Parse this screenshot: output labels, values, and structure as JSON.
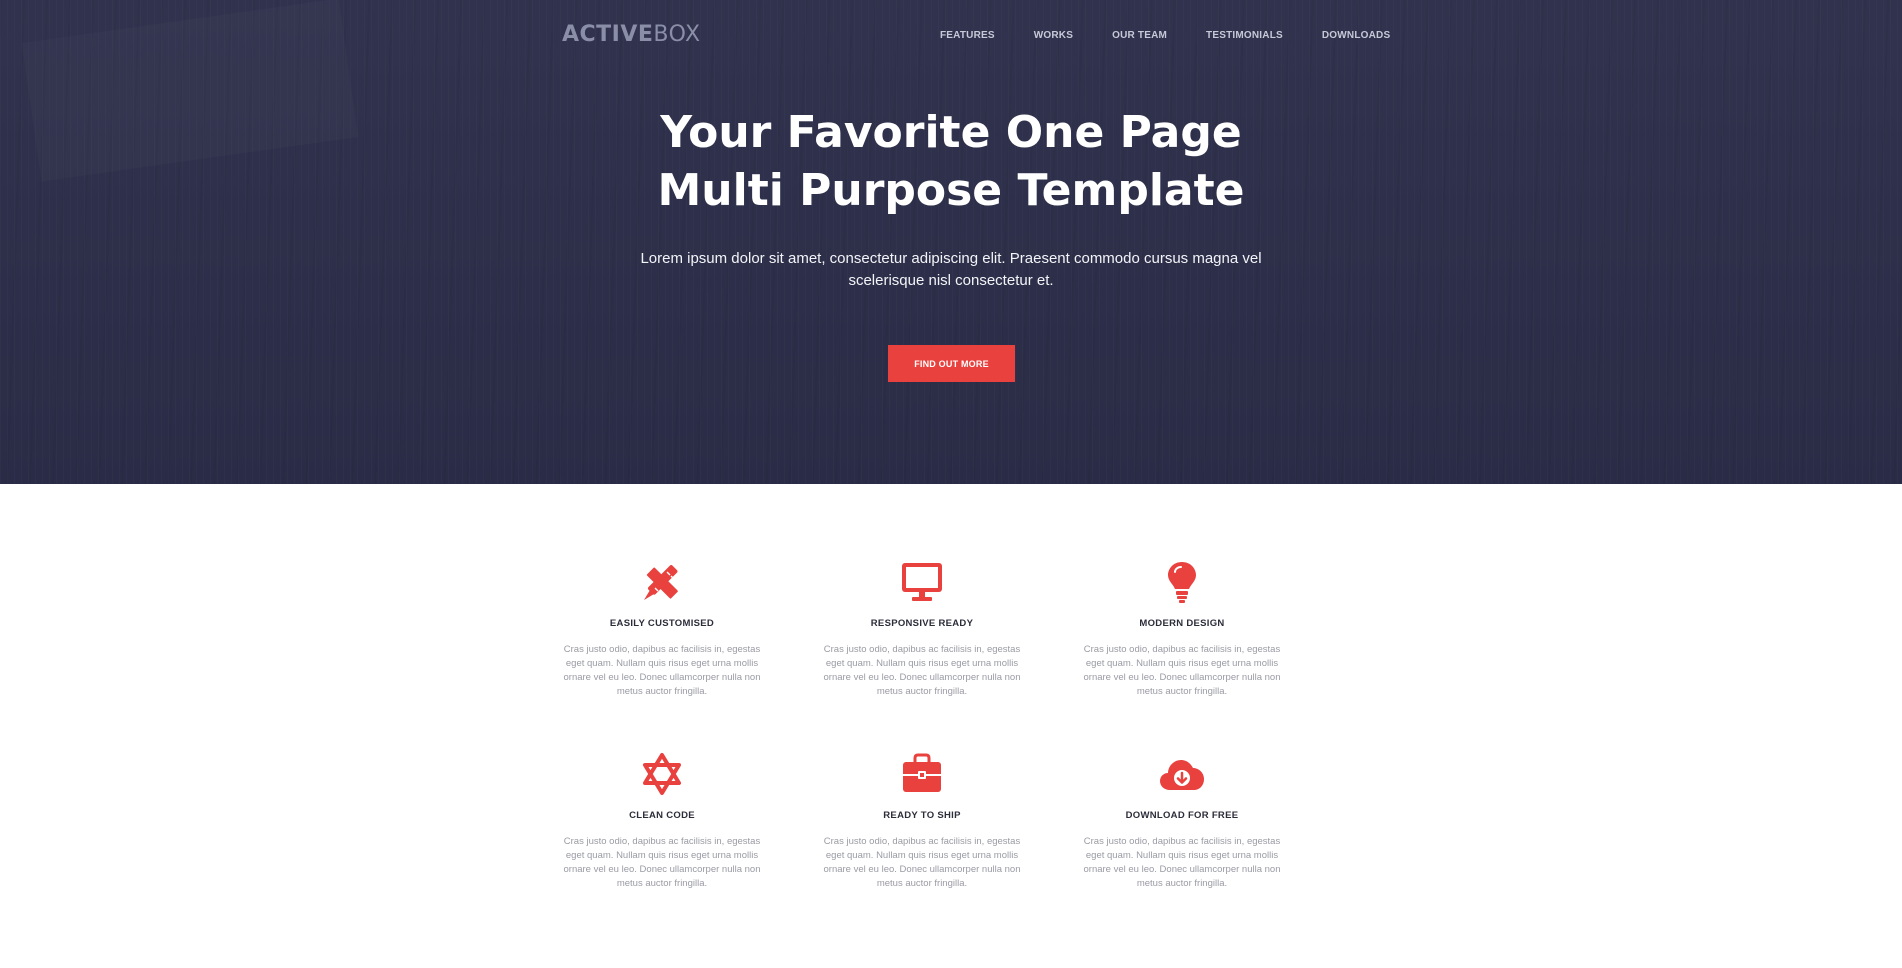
{
  "brand": {
    "logo_bold": "ACTIVE",
    "logo_light": "BOX"
  },
  "nav": {
    "items": [
      "FEATURES",
      "WORKS",
      "OUR TEAM",
      "TESTIMONIALS",
      "DOWNLOADS"
    ]
  },
  "hero": {
    "title_line1": "Your Favorite One Page",
    "title_line2": "Multi Purpose Template",
    "subtitle": "Lorem ipsum dolor sit amet, consectetur adipiscing elit. Praesent commodo cursus magna vel scelerisque nisl consectetur et.",
    "cta_label": "FIND OUT MORE"
  },
  "colors": {
    "accent": "#e8413e",
    "hero_bg": "#2d2f4b"
  },
  "features": [
    {
      "icon": "pencil-ruler-icon",
      "title": "EASILY CUSTOMISED",
      "text": "Cras justo odio, dapibus ac facilisis in, egestas eget quam. Nullam quis risus eget urna mollis ornare vel eu leo. Donec ullamcorper nulla non metus auctor fringilla."
    },
    {
      "icon": "monitor-icon",
      "title": "RESPONSIVE READY",
      "text": "Cras justo odio, dapibus ac facilisis in, egestas eget quam. Nullam quis risus eget urna mollis ornare vel eu leo. Donec ullamcorper nulla non metus auctor fringilla."
    },
    {
      "icon": "lightbulb-icon",
      "title": "MODERN DESIGN",
      "text": "Cras justo odio, dapibus ac facilisis in, egestas eget quam. Nullam quis risus eget urna mollis ornare vel eu leo. Donec ullamcorper nulla non metus auctor fringilla."
    },
    {
      "icon": "star-of-david-icon",
      "title": "CLEAN CODE",
      "text": "Cras justo odio, dapibus ac facilisis in, egestas eget quam. Nullam quis risus eget urna mollis ornare vel eu leo. Donec ullamcorper nulla non metus auctor fringilla."
    },
    {
      "icon": "briefcase-icon",
      "title": "READY TO SHIP",
      "text": "Cras justo odio, dapibus ac facilisis in, egestas eget quam. Nullam quis risus eget urna mollis ornare vel eu leo. Donec ullamcorper nulla non metus auctor fringilla."
    },
    {
      "icon": "cloud-download-icon",
      "title": "DOWNLOAD FOR FREE",
      "text": "Cras justo odio, dapibus ac facilisis in, egestas eget quam. Nullam quis risus eget urna mollis ornare vel eu leo. Donec ullamcorper nulla non metus auctor fringilla."
    }
  ]
}
